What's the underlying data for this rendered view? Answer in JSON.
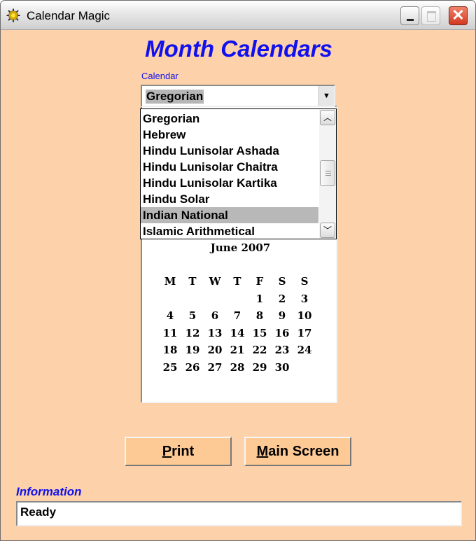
{
  "window": {
    "title": "Calendar Magic"
  },
  "heading": "Month Calendars",
  "calendar_select": {
    "label": "Calendar",
    "value": "Gregorian",
    "options": [
      "Gregorian",
      "Hebrew",
      "Hindu Lunisolar Ashada",
      "Hindu Lunisolar Chaitra",
      "Hindu Lunisolar Kartika",
      "Hindu Solar",
      "Indian National",
      "Islamic Arithmetical"
    ],
    "highlighted": "Indian National"
  },
  "month_view": {
    "title": "June 2007",
    "weekdays": [
      "M",
      "T",
      "W",
      "T",
      "F",
      "S",
      "S"
    ],
    "weeks": [
      [
        "",
        "",
        "",
        "",
        "1",
        "2",
        "3"
      ],
      [
        "4",
        "5",
        "6",
        "7",
        "8",
        "9",
        "10"
      ],
      [
        "11",
        "12",
        "13",
        "14",
        "15",
        "16",
        "17"
      ],
      [
        "18",
        "19",
        "20",
        "21",
        "22",
        "23",
        "24"
      ],
      [
        "25",
        "26",
        "27",
        "28",
        "29",
        "30",
        ""
      ]
    ]
  },
  "buttons": {
    "print": {
      "mnemonic": "P",
      "rest": "rint"
    },
    "main_screen": {
      "mnemonic": "M",
      "rest": "ain Screen"
    }
  },
  "information": {
    "label": "Information",
    "value": "Ready"
  },
  "icons": {
    "app": "sun-gear-icon",
    "min": "minimize-icon",
    "max": "maximize-icon",
    "close": "close-icon"
  },
  "colors": {
    "background": "#fdd2aa",
    "accent": "#1111ee",
    "button": "#fdc994",
    "close": "#d2391f"
  }
}
